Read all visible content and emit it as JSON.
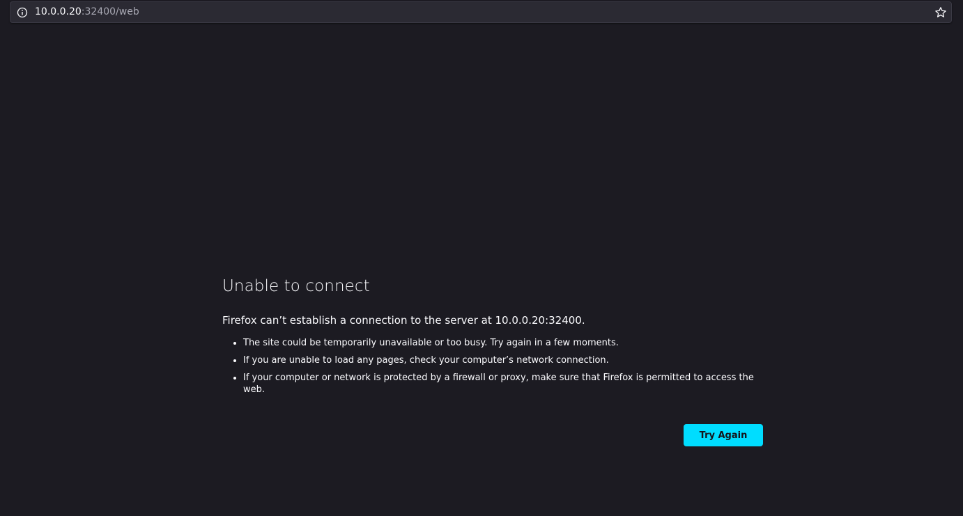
{
  "browser": {
    "url_host": "10.0.0.20",
    "url_rest": ":32400/web",
    "icons": {
      "site_info": "info-circle-icon",
      "bookmark": "star-icon"
    }
  },
  "error": {
    "title": "Unable to connect",
    "description": "Firefox can’t establish a connection to the server at 10.0.0.20:32400.",
    "tips": [
      "The site could be temporarily unavailable or too busy. Try again in a few moments.",
      "If you are unable to load any pages, check your computer’s network connection.",
      "If your computer or network is protected by a firewall or proxy, make sure that Firefox is permitted to access the web."
    ],
    "button_label": "Try Again"
  },
  "colors": {
    "background": "#1c1b22",
    "urlbar": "#2b2a33",
    "accent_button": "#00ddff",
    "text": "#fbfbfe",
    "url_secondary": "#a8a8b3"
  }
}
